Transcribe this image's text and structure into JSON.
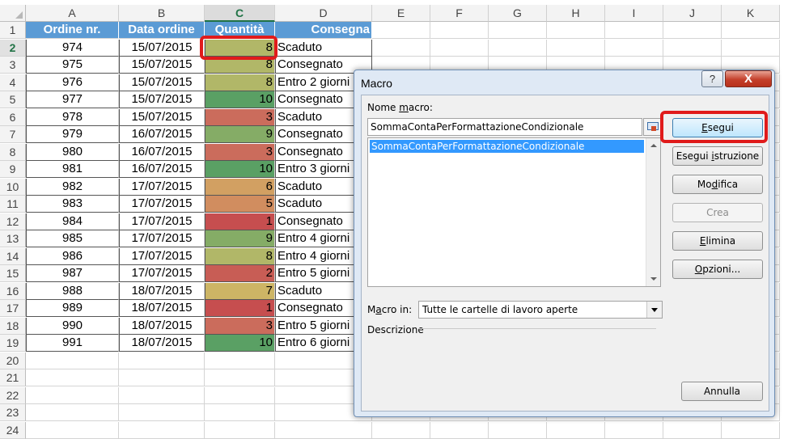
{
  "sheet": {
    "columns": [
      "A",
      "B",
      "C",
      "D",
      "E",
      "F",
      "G",
      "H",
      "I",
      "J",
      "K"
    ],
    "selected_column": "C",
    "header": {
      "a": "Ordine nr.",
      "b": "Data ordine",
      "c": "Quantità",
      "d": "Consegna"
    },
    "rows": [
      {
        "n": "2",
        "order": "974",
        "date": "15/07/2015",
        "qty": "8",
        "delivery": "Scaduto",
        "color": "#b1b768"
      },
      {
        "n": "3",
        "order": "975",
        "date": "15/07/2015",
        "qty": "8",
        "delivery": "Consegnato",
        "color": "#b1b768"
      },
      {
        "n": "4",
        "order": "976",
        "date": "15/07/2015",
        "qty": "8",
        "delivery": "Entro 2 giorni",
        "color": "#b1b768"
      },
      {
        "n": "5",
        "order": "977",
        "date": "15/07/2015",
        "qty": "10",
        "delivery": "Consegnato",
        "color": "#5aa064"
      },
      {
        "n": "6",
        "order": "978",
        "date": "15/07/2015",
        "qty": "3",
        "delivery": "Scaduto",
        "color": "#cb6c5c"
      },
      {
        "n": "7",
        "order": "979",
        "date": "16/07/2015",
        "qty": "9",
        "delivery": "Consegnato",
        "color": "#85ac66"
      },
      {
        "n": "8",
        "order": "980",
        "date": "16/07/2015",
        "qty": "3",
        "delivery": "Consegnato",
        "color": "#cb6c5c"
      },
      {
        "n": "9",
        "order": "981",
        "date": "16/07/2015",
        "qty": "10",
        "delivery": "Entro 3 giorni",
        "color": "#5aa064"
      },
      {
        "n": "10",
        "order": "982",
        "date": "17/07/2015",
        "qty": "6",
        "delivery": "Scaduto",
        "color": "#d2a062"
      },
      {
        "n": "11",
        "order": "983",
        "date": "17/07/2015",
        "qty": "5",
        "delivery": "Scaduto",
        "color": "#d18d5f"
      },
      {
        "n": "12",
        "order": "984",
        "date": "17/07/2015",
        "qty": "1",
        "delivery": "Consegnato",
        "color": "#c64e4f"
      },
      {
        "n": "13",
        "order": "985",
        "date": "17/07/2015",
        "qty": "9",
        "delivery": "Entro 4 giorni",
        "color": "#85ac66"
      },
      {
        "n": "14",
        "order": "986",
        "date": "17/07/2015",
        "qty": "8",
        "delivery": "Entro 4 giorni",
        "color": "#b1b768"
      },
      {
        "n": "15",
        "order": "987",
        "date": "17/07/2015",
        "qty": "2",
        "delivery": "Entro 5 giorni",
        "color": "#c85d55"
      },
      {
        "n": "16",
        "order": "988",
        "date": "18/07/2015",
        "qty": "7",
        "delivery": "Scaduto",
        "color": "#cdb565"
      },
      {
        "n": "17",
        "order": "989",
        "date": "18/07/2015",
        "qty": "1",
        "delivery": "Consegnato",
        "color": "#c64e4f"
      },
      {
        "n": "18",
        "order": "990",
        "date": "18/07/2015",
        "qty": "3",
        "delivery": "Entro 5 giorni",
        "color": "#cb6c5c"
      },
      {
        "n": "19",
        "order": "991",
        "date": "18/07/2015",
        "qty": "10",
        "delivery": "Entro 6 giorni",
        "color": "#5aa064"
      }
    ],
    "empty_rows": [
      "20",
      "21",
      "22",
      "23",
      "24"
    ],
    "header_row_number": "1"
  },
  "dialog": {
    "title": "Macro",
    "help_label": "?",
    "close_label": "X",
    "macro_name_label": "Nome macro:",
    "macro_name_value": "SommaContaPerFormattazioneCondizionale",
    "macro_list": [
      "SommaContaPerFormattazioneCondizionale"
    ],
    "macro_in_label": "Macro in:",
    "macro_in_value": "Tutte le cartelle di lavoro aperte",
    "description_label": "Descrizione",
    "buttons": {
      "run": "Esegui",
      "step_into": "Esegui istruzione",
      "edit": "Modifica",
      "create": "Crea",
      "delete": "Elimina",
      "options": "Opzioni...",
      "cancel": "Annulla"
    }
  },
  "colors": {
    "header_fill": "#5b9bd5",
    "highlight": "#e01b1b",
    "selected_header_text": "#217346"
  }
}
